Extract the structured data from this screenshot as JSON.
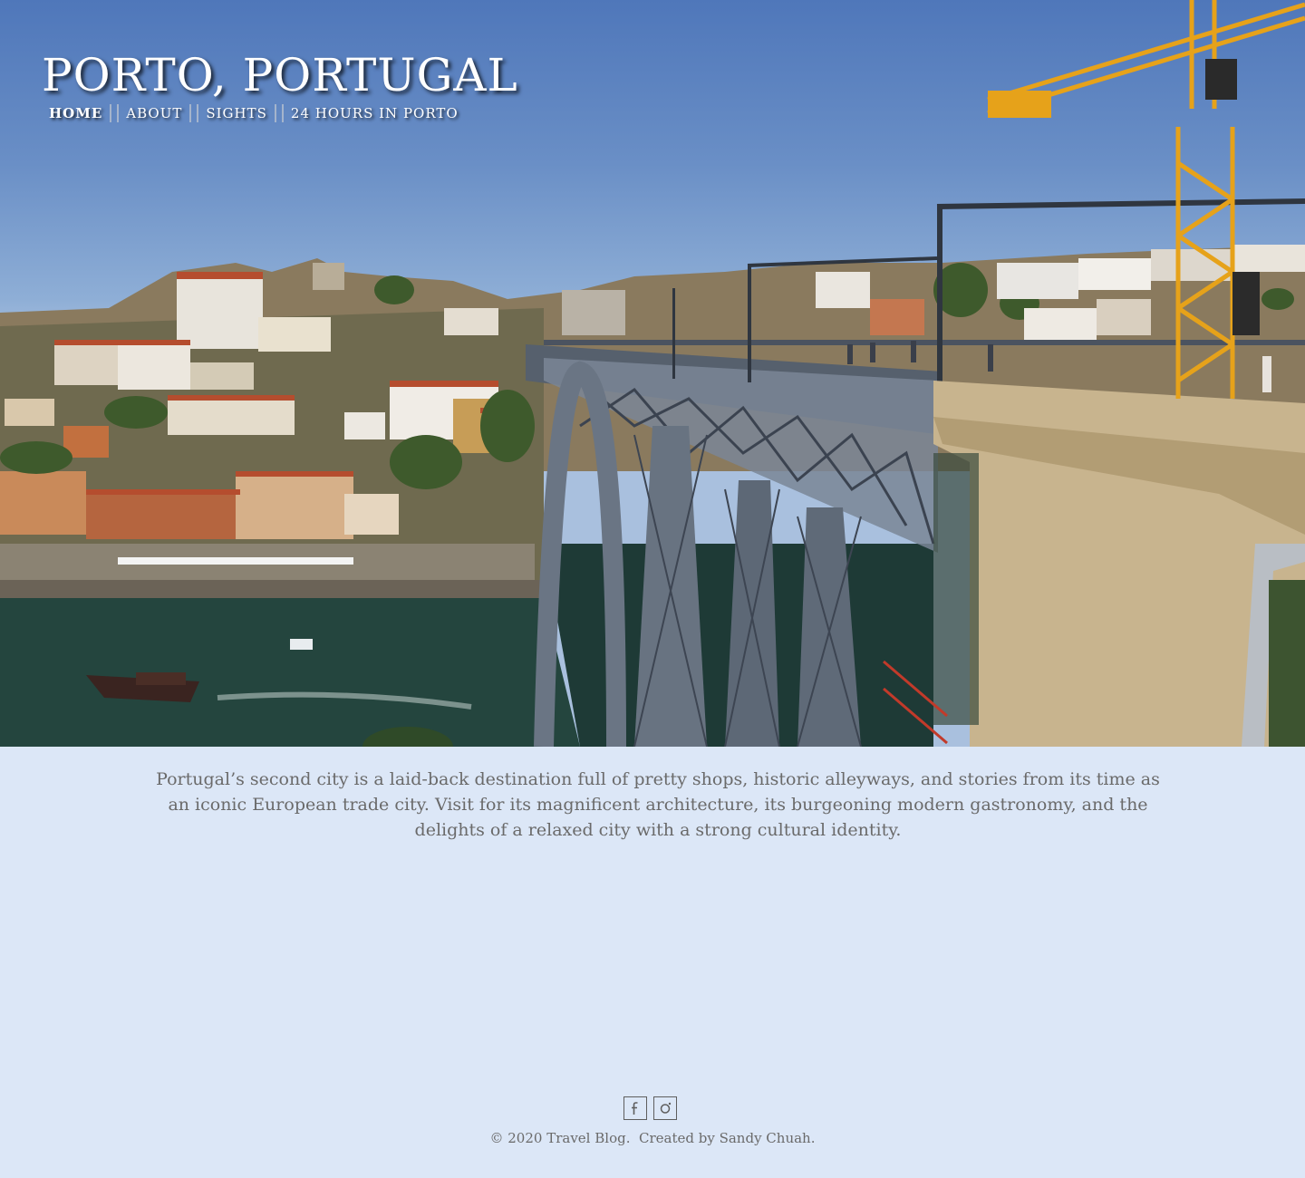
{
  "site": {
    "title": "PORTO, PORTUGAL"
  },
  "nav": [
    {
      "label": "HOME",
      "active": true
    },
    {
      "label": "ABOUT",
      "active": false
    },
    {
      "label": "SIGHTS",
      "active": false
    },
    {
      "label": "24 HOURS IN PORTO",
      "active": false
    }
  ],
  "hero": {
    "image": "photo of the Dom Luís I bridge over the Douro river with the Ribeira hillside and a yellow crane"
  },
  "intro": {
    "text": "Portugal’s second city is a laid-back destination full of pretty shops, historic alleyways, and stories from its time as an iconic European trade city. Visit for its magnificent architecture, its burgeoning modern gastronomy, and the delights of a relaxed city with a strong cultural identity."
  },
  "footer": {
    "social": [
      {
        "icon": "facebook-icon"
      },
      {
        "icon": "instagram-icon"
      }
    ],
    "copyright": "© 2020 Travel Blog.  Created by Sandy Chuah."
  },
  "colors": {
    "page_background": "#dce7f7",
    "body_text": "#6a6a6a",
    "nav_text": "#ffffff"
  }
}
